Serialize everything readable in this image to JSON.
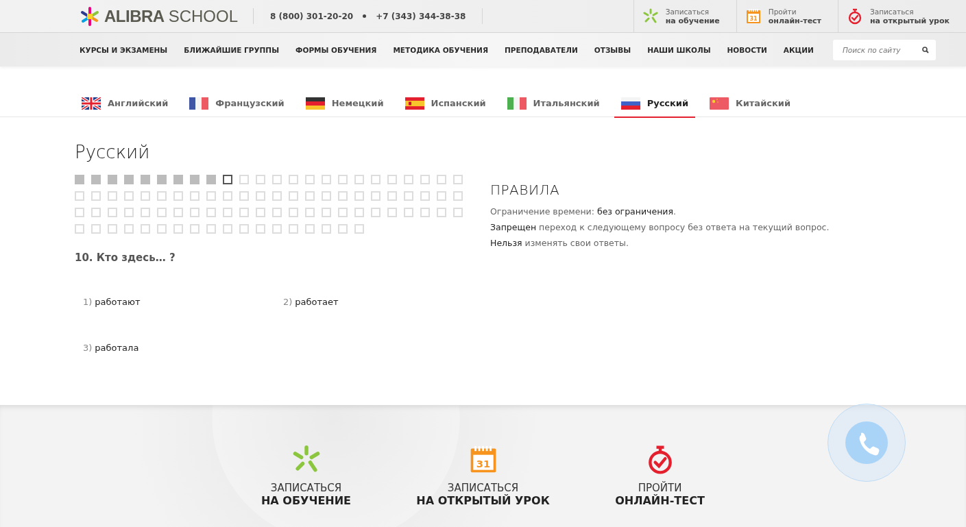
{
  "header": {
    "logo": {
      "bold": "ALIBRA",
      "light": "SCHOOL"
    },
    "phones": [
      "8 (800) 301-20-20",
      "+7 (343) 344-38-38"
    ],
    "actions": [
      {
        "kind": "signup",
        "top": "Записаться",
        "bottom": "на обучение"
      },
      {
        "kind": "calendar",
        "icon_text": "31",
        "top": "Пройти",
        "bottom": "онлайн-тест"
      },
      {
        "kind": "timer",
        "top": "Записаться",
        "bottom": "на открытый урок"
      }
    ]
  },
  "nav": {
    "items": [
      "КУРСЫ И ЭКЗАМЕНЫ",
      "БЛИЖАЙШИЕ ГРУППЫ",
      "ФОРМЫ ОБУЧЕНИЯ",
      "МЕТОДИКА ОБУЧЕНИЯ",
      "ПРЕПОДАВАТЕЛИ",
      "ОТЗЫВЫ",
      "НАШИ ШКОЛЫ",
      "НОВОСТИ",
      "АКЦИИ"
    ],
    "search": {
      "placeholder": "Поиск по сайту"
    }
  },
  "tabs": [
    {
      "label": "Английский",
      "kind": "gb",
      "selected": false
    },
    {
      "label": "Французский",
      "kind": "fr",
      "selected": false
    },
    {
      "label": "Немецкий",
      "kind": "de",
      "selected": false
    },
    {
      "label": "Испанский",
      "kind": "es",
      "selected": false
    },
    {
      "label": "Итальянский",
      "kind": "it",
      "selected": false
    },
    {
      "label": "Русский",
      "kind": "ru",
      "selected": true
    },
    {
      "label": "Китайский",
      "kind": "cn",
      "selected": false
    }
  ],
  "test": {
    "title": "Русский",
    "progress": [
      {
        "kind": "answered"
      },
      {
        "kind": "answered"
      },
      {
        "kind": "answered"
      },
      {
        "kind": "answered"
      },
      {
        "kind": "answered"
      },
      {
        "kind": "answered"
      },
      {
        "kind": "answered"
      },
      {
        "kind": "answered"
      },
      {
        "kind": "answered"
      },
      {
        "kind": "current"
      },
      {
        "kind": "empty"
      },
      {
        "kind": "empty"
      },
      {
        "kind": "empty"
      },
      {
        "kind": "empty"
      },
      {
        "kind": "empty"
      },
      {
        "kind": "empty"
      },
      {
        "kind": "empty"
      },
      {
        "kind": "empty"
      },
      {
        "kind": "empty"
      },
      {
        "kind": "empty"
      },
      {
        "kind": "empty"
      },
      {
        "kind": "empty"
      },
      {
        "kind": "empty"
      },
      {
        "kind": "empty"
      },
      {
        "kind": "empty"
      },
      {
        "kind": "empty"
      },
      {
        "kind": "empty"
      },
      {
        "kind": "empty"
      },
      {
        "kind": "empty"
      },
      {
        "kind": "empty"
      },
      {
        "kind": "empty"
      },
      {
        "kind": "empty"
      },
      {
        "kind": "empty"
      },
      {
        "kind": "empty"
      },
      {
        "kind": "empty"
      },
      {
        "kind": "empty"
      },
      {
        "kind": "empty"
      },
      {
        "kind": "empty"
      },
      {
        "kind": "empty"
      },
      {
        "kind": "empty"
      },
      {
        "kind": "empty"
      },
      {
        "kind": "empty"
      },
      {
        "kind": "empty"
      },
      {
        "kind": "empty"
      },
      {
        "kind": "empty"
      },
      {
        "kind": "empty"
      },
      {
        "kind": "empty"
      },
      {
        "kind": "empty"
      },
      {
        "kind": "empty"
      },
      {
        "kind": "empty"
      },
      {
        "kind": "empty"
      },
      {
        "kind": "empty"
      },
      {
        "kind": "empty"
      },
      {
        "kind": "empty"
      },
      {
        "kind": "empty"
      },
      {
        "kind": "empty"
      },
      {
        "kind": "empty"
      },
      {
        "kind": "empty"
      },
      {
        "kind": "empty"
      },
      {
        "kind": "empty"
      },
      {
        "kind": "empty"
      },
      {
        "kind": "empty"
      },
      {
        "kind": "empty"
      },
      {
        "kind": "empty"
      },
      {
        "kind": "empty"
      },
      {
        "kind": "empty"
      },
      {
        "kind": "empty"
      },
      {
        "kind": "empty"
      },
      {
        "kind": "empty"
      },
      {
        "kind": "empty"
      },
      {
        "kind": "empty"
      },
      {
        "kind": "empty"
      },
      {
        "kind": "empty"
      },
      {
        "kind": "empty"
      },
      {
        "kind": "empty"
      },
      {
        "kind": "empty"
      },
      {
        "kind": "empty"
      },
      {
        "kind": "empty"
      },
      {
        "kind": "empty"
      },
      {
        "kind": "empty"
      },
      {
        "kind": "empty"
      },
      {
        "kind": "empty"
      },
      {
        "kind": "empty"
      },
      {
        "kind": "empty"
      },
      {
        "kind": "empty"
      },
      {
        "kind": "empty"
      },
      {
        "kind": "empty"
      },
      {
        "kind": "empty"
      },
      {
        "kind": "empty"
      },
      {
        "kind": "empty"
      }
    ],
    "question": "10. Кто здесь… ?",
    "options": [
      {
        "number": "1)",
        "text": "работают"
      },
      {
        "number": "2)",
        "text": "работает"
      },
      {
        "number": "3)",
        "text": "работала"
      }
    ],
    "rules": {
      "title": "ПРАВИЛА",
      "lines": [
        "Ограничение времени: **без ограничения**.",
        "**Запрещен** переход к следующему вопросу без ответа на текущий вопрос.",
        "**Нельзя** изменять свои ответы."
      ]
    }
  },
  "footer": {
    "actions": [
      {
        "kind": "signup",
        "top": "ЗАПИСАТЬСЯ",
        "bottom": "НА ОБУЧЕНИЕ"
      },
      {
        "kind": "calendar",
        "icon_text": "31",
        "top": "ЗАПИСАТЬСЯ",
        "bottom": "НА ОТКРЫТЫЙ УРОК"
      },
      {
        "kind": "timer",
        "top": "ПРОЙТИ",
        "bottom": "ОНЛАЙН-ТЕСТ"
      }
    ]
  }
}
